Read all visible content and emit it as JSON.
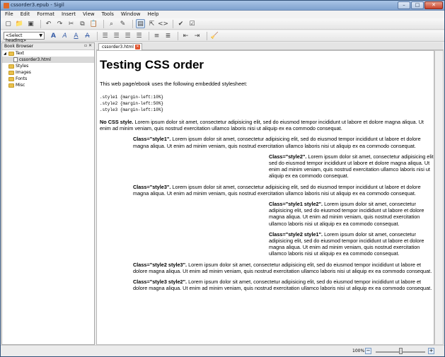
{
  "window": {
    "title": "cssorder3.epub - Sigil"
  },
  "menus": [
    "File",
    "Edit",
    "Format",
    "Insert",
    "View",
    "Tools",
    "Window",
    "Help"
  ],
  "toolbar": {
    "heading_select": "<Select heading>"
  },
  "book_browser": {
    "title": "Book Browser",
    "items": [
      {
        "label": "Text",
        "type": "folder",
        "level": 0
      },
      {
        "label": "cssorder3.html",
        "type": "file",
        "level": 1
      },
      {
        "label": "Styles",
        "type": "folder",
        "level": 0
      },
      {
        "label": "Images",
        "type": "folder",
        "level": 0
      },
      {
        "label": "Fonts",
        "type": "folder",
        "level": 0
      },
      {
        "label": "Misc",
        "type": "folder",
        "level": 0
      }
    ]
  },
  "tab": {
    "label": "cssorder3.html"
  },
  "document": {
    "heading": "Testing CSS order",
    "intro": "This web page/ebook uses the following embedded stylesheet:",
    "stylesheet": ".style1 {margin-left:10%}\n.style2 {margin-left:50%}\n.style3 {margin-left:10%}",
    "lorem": "Lorem ipsum dolor sit amet, consectetur adipisicing elit, sed do eiusmod tempor incididunt ut labore et dolore magna aliqua. Ut enim ad minim veniam, quis nostrud exercitation ullamco laboris nisi ut aliquip ex ea commodo consequat.",
    "paragraphs": [
      {
        "label": "No CSS style.",
        "indent": "none"
      },
      {
        "label": "Class=\"style1\".",
        "indent": "s1"
      },
      {
        "label": "Class=\"style2\".",
        "indent": "s2"
      },
      {
        "label": "Class=\"style3\".",
        "indent": "s1"
      },
      {
        "label": "Class=\"style1 style2\".",
        "indent": "s2"
      },
      {
        "label": "Class=\"style2 style1\".",
        "indent": "s2"
      },
      {
        "label": "Class=\"style2 style3\".",
        "indent": "s1"
      },
      {
        "label": "Class=\"style3 style2\".",
        "indent": "s1"
      }
    ]
  },
  "statusbar": {
    "zoom": "100%"
  }
}
